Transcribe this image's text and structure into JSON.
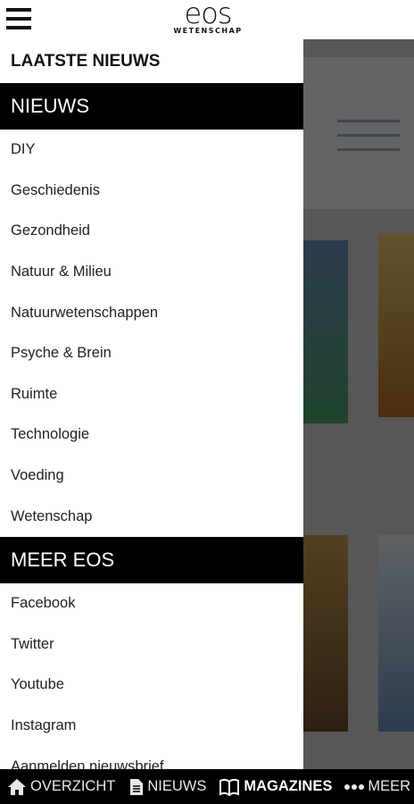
{
  "header": {
    "menu_icon": "hamburger-menu-icon",
    "logo_main": "eos",
    "logo_sub": "WETENSCHAP"
  },
  "drawer": {
    "top_item": "LAATSTE NIEUWS",
    "sections": [
      {
        "title": "NIEUWS",
        "items": [
          "DIY",
          "Geschiedenis",
          "Gezondheid",
          "Natuur & Milieu",
          "Natuurwetenschappen",
          "Psyche & Brein",
          "Ruimte",
          "Technologie",
          "Voeding",
          "Wetenschap"
        ]
      },
      {
        "title": "MEER EOS",
        "items": [
          "Facebook",
          "Twitter",
          "Youtube",
          "Instagram",
          "Aanmelden nieuwsbrief"
        ]
      }
    ]
  },
  "bottom_nav": {
    "tabs": [
      {
        "label": "OVERZICHT",
        "icon": "home-icon",
        "active": false
      },
      {
        "label": "NIEUWS",
        "icon": "document-icon",
        "active": false
      },
      {
        "label": "MAGAZINES",
        "icon": "book-icon",
        "active": true
      },
      {
        "label": "MEER",
        "icon": "more-dots-icon",
        "active": false
      }
    ]
  }
}
